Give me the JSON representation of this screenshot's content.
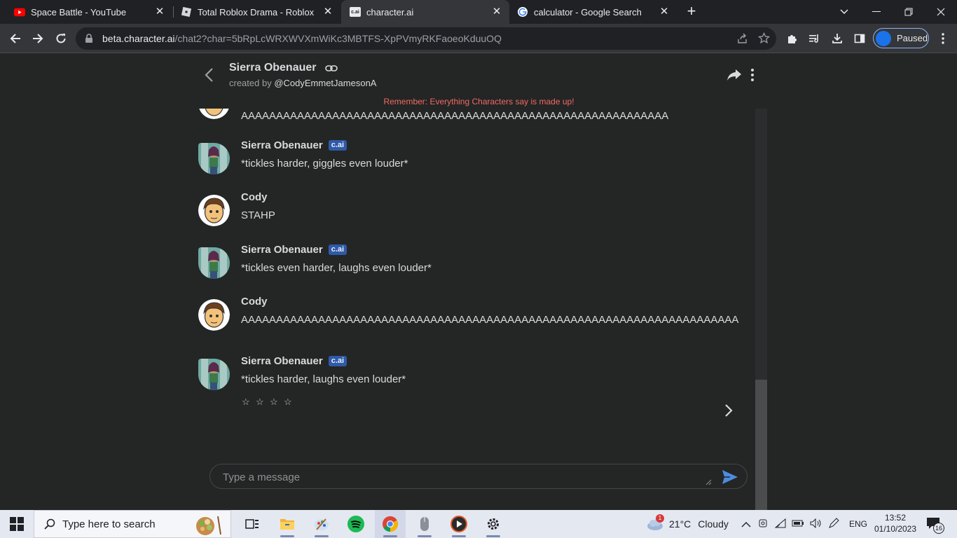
{
  "browser": {
    "tabs": [
      {
        "title": "Space Battle - YouTube",
        "icon": "youtube-icon",
        "active": false
      },
      {
        "title": "Total Roblox Drama - Roblox",
        "icon": "roblox-icon",
        "active": false
      },
      {
        "title": "character.ai",
        "icon": "cai-icon",
        "active": true
      },
      {
        "title": "calculator - Google Search",
        "icon": "google-icon",
        "active": false
      }
    ],
    "favicon_cai_text": "c.ai",
    "url_host": "beta.character.ai",
    "url_path": "/chat2?char=5bRpLcWRXWVXmWiKc3MBTFS-XpPVmyRKFaoeoKduuOQ",
    "profile_status": "Paused"
  },
  "header": {
    "character_name": "Sierra Obenauer",
    "created_by_prefix": "created by",
    "author": "@CodyEmmetJamesonA"
  },
  "reminder": "Remember: Everything Characters say is made up!",
  "messages": [
    {
      "sender": "",
      "text": "AAAAAAAAAAAAAAAAAAAAAAAAAAAAAAAAAAAAAAAAAAAAAAAAAAAAAAAAAAAAA",
      "is_ai": false,
      "avatar": "cody"
    },
    {
      "sender": "Sierra Obenauer",
      "text": "*tickles harder, giggles even louder*",
      "is_ai": true,
      "avatar": "sierra"
    },
    {
      "sender": "Cody",
      "text": "STAHP",
      "is_ai": false,
      "avatar": "cody"
    },
    {
      "sender": "Sierra Obenauer",
      "text": "*tickles even harder, laughs even louder*",
      "is_ai": true,
      "avatar": "sierra"
    },
    {
      "sender": "Cody",
      "text": "AAAAAAAAAAAAAAAAAAAAAAAAAAAAAAAAAAAAAAAAAAAAAAAAAAAAAAAAAAAAAAAAAAAAAAA",
      "is_ai": false,
      "avatar": "cody"
    },
    {
      "sender": "Sierra Obenauer",
      "text": "*tickles harder, laughs even louder*",
      "is_ai": true,
      "avatar": "sierra"
    }
  ],
  "ai_badge": "c.ai",
  "rating_stars": 4,
  "composer": {
    "placeholder": "Type a message"
  },
  "taskbar": {
    "search_placeholder": "Type here to search",
    "weather_temp": "21°C",
    "weather_desc": "Cloudy",
    "weather_badge": "1",
    "lang": "ENG",
    "time": "13:52",
    "date": "01/10/2023",
    "notification_count": "16"
  },
  "colors": {
    "page_bg": "#242525",
    "reminder": "#ef6b64",
    "badge": "#2f5aa8",
    "send": "#4c8ce0"
  }
}
